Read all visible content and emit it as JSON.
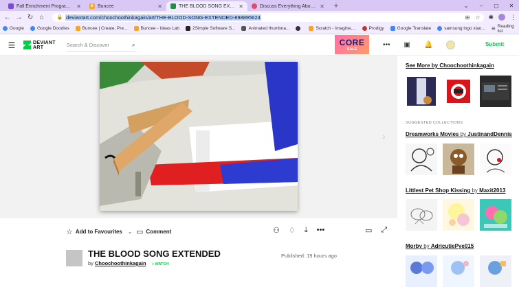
{
  "browser": {
    "tabs": [
      {
        "title": "Fall Enrichment Program - Testi",
        "fav_color": "#7b4ad6",
        "fav_glyph": "",
        "active": false
      },
      {
        "title": "Buncee",
        "fav_color": "#f5a623",
        "fav_glyph": "b",
        "active": false
      },
      {
        "title": "THE BLOOD SONG EXTENDED b",
        "fav_color": "#1e8f45",
        "fav_glyph": "",
        "active": true
      },
      {
        "title": "Discuss Everything About Numb",
        "fav_color": "#e24a6a",
        "fav_glyph": "",
        "active": false
      }
    ],
    "new_tab": "+",
    "window_controls": [
      "⌄",
      "–",
      "▢",
      "✕"
    ],
    "url": "deviantart.com/choochoothinkagain/art/THE-BLOOD-SONG-EXTENDED-898895624",
    "bookmarks": [
      {
        "label": "Google",
        "color": "#4285f4"
      },
      {
        "label": "Google Doodles",
        "color": "#4285f4"
      },
      {
        "label": "Buncee | Create, Pre...",
        "color": "#f5a623"
      },
      {
        "label": "Buncee - Ideas Lab",
        "color": "#f5a623"
      },
      {
        "label": "2Simple Software S...",
        "color": "#222222"
      },
      {
        "label": "Animated thumbna...",
        "color": "#555555"
      },
      {
        "label": "",
        "color": "#333333"
      },
      {
        "label": "Scratch - Imagine,...",
        "color": "#f7a327"
      },
      {
        "label": "Prodigy",
        "color": "#c0392b"
      },
      {
        "label": "Google Translate",
        "color": "#4285f4"
      },
      {
        "label": "samsung logo xiao...",
        "color": "#4285f4"
      }
    ],
    "reading_list": "Reading list"
  },
  "site": {
    "logo_line1": "DEVIANT",
    "logo_line2": "ART",
    "search_placeholder": "Search & Discover",
    "promo_line1": "CORE",
    "promo_line2": "SALE",
    "submit": "Submit"
  },
  "deviation": {
    "add_to_favourites": "Add to Favourites",
    "comment": "Comment",
    "title": "THE BLOOD SONG EXTENDED",
    "by": "by",
    "author": "Choochoothinkagain",
    "watch": "+ WATCH",
    "published": "Published: 19 hours ago"
  },
  "sidebar": {
    "see_more_prefix": "See More by ",
    "see_more_author": "Choochoothinkagain",
    "suggested_heading": "SUGGESTED COLLECTIONS",
    "collections": [
      {
        "name": "Dreamworks Movies",
        "by": " by ",
        "author": "JustinandDennis"
      },
      {
        "name": "Littlest Pet Shop Kissing",
        "by": " by ",
        "author": "Maxit2013"
      },
      {
        "name": "Morby",
        "by": " by ",
        "author": "AdricutiePye015"
      }
    ]
  },
  "colors": {
    "brand_green": "#05cc47",
    "tabstrip": "#d9c8f5",
    "toolbar": "#f3ecff"
  }
}
